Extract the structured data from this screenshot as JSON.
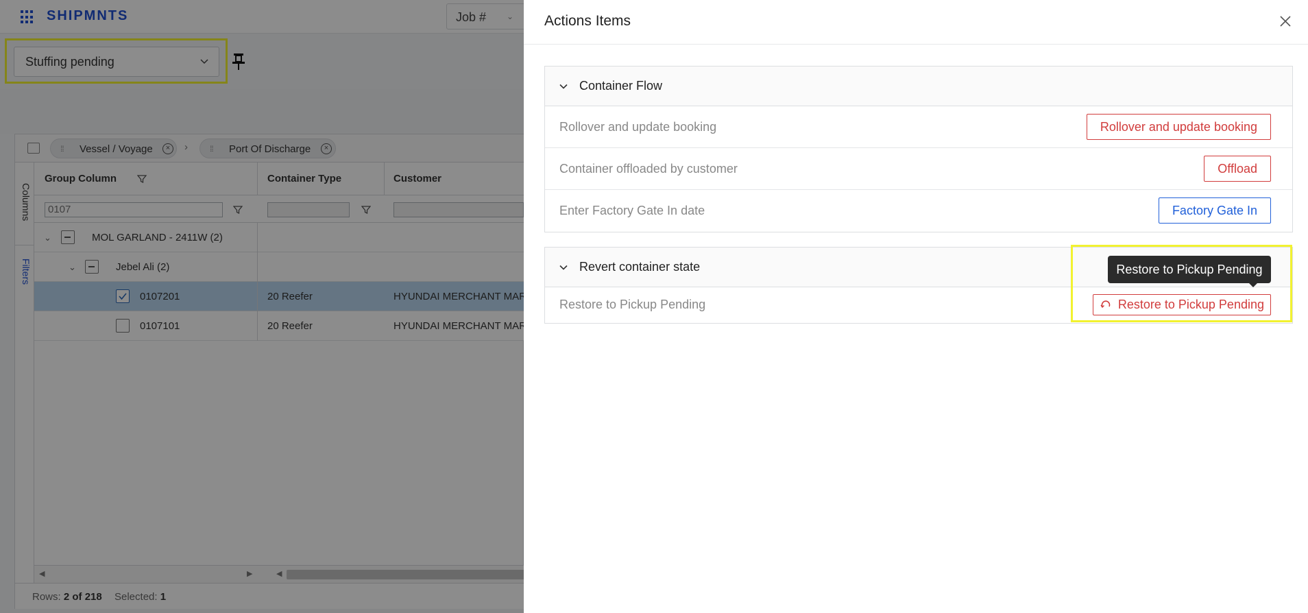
{
  "app": {
    "brand": "SHIPMNTS"
  },
  "topbar": {
    "search_field_label": "Job #"
  },
  "view_selector": {
    "value": "Stuffing pending"
  },
  "grid": {
    "group_chips": [
      "Vessel / Voyage",
      "Port Of Discharge"
    ],
    "side_tabs": {
      "columns": "Columns",
      "filters": "Filters"
    },
    "columns": [
      "Group Column",
      "Container Type",
      "Customer"
    ],
    "filter_value": "0107",
    "rows": [
      {
        "label": "MOL GARLAND - 2411W (2)",
        "level": 0
      },
      {
        "label": "Jebel Ali (2)",
        "level": 1
      },
      {
        "id": "0107201",
        "container_type": "20 Reefer",
        "customer": "HYUNDAI MERCHANT MAR",
        "checked": true
      },
      {
        "id": "0107101",
        "container_type": "20 Reefer",
        "customer": "HYUNDAI MERCHANT MAR",
        "checked": false
      }
    ],
    "status": {
      "rows_label": "Rows:",
      "rows_value": "2 of 218",
      "selected_label": "Selected:",
      "selected_value": "1"
    }
  },
  "drawer": {
    "title": "Actions Items",
    "sections": [
      {
        "title": "Container Flow",
        "rows": [
          {
            "description": "Rollover and update booking",
            "button": "Rollover and update booking",
            "style": "danger"
          },
          {
            "description": "Container offloaded by customer",
            "button": "Offload",
            "style": "danger"
          },
          {
            "description": "Enter Factory Gate In date",
            "button": "Factory Gate In",
            "style": "primary"
          }
        ]
      },
      {
        "title": "Revert container state",
        "rows": [
          {
            "description": "Restore to Pickup Pending",
            "button": "Restore to Pickup Pending",
            "style": "danger"
          }
        ]
      }
    ],
    "tooltip": "Restore to Pickup Pending"
  },
  "colors": {
    "brand": "#1f4fd1",
    "danger": "#d13c3c",
    "primary": "#2160d9",
    "highlight": "#f2f230",
    "selected_row": "#b9d6ee"
  }
}
